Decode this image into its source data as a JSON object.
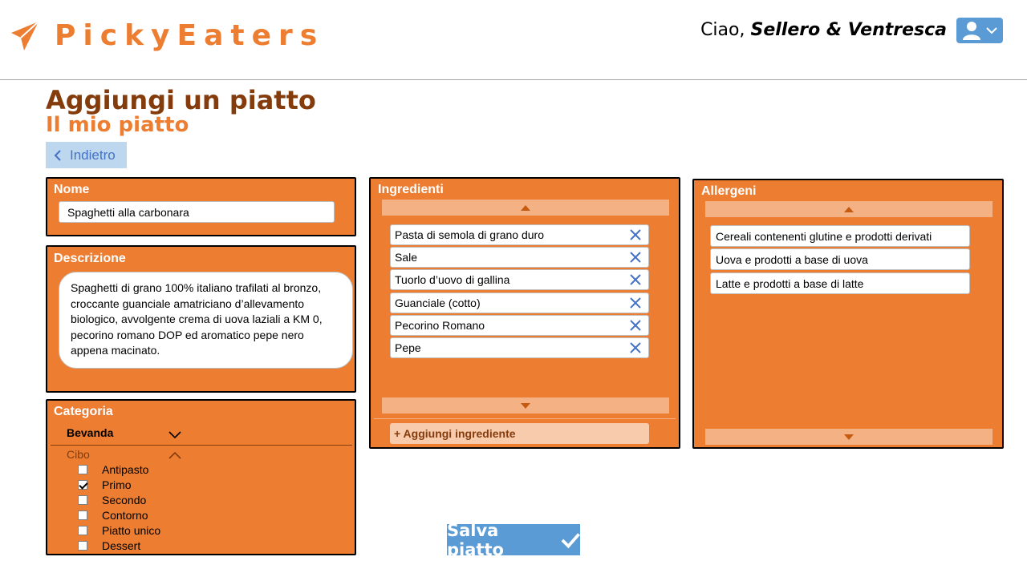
{
  "app": {
    "name": "PickyEaters"
  },
  "header": {
    "greeting": "Ciao,",
    "user": "Sellero & Ventresca"
  },
  "page": {
    "title": "Aggiungi un piatto",
    "subtitle": "Il mio piatto",
    "back_label": "Indietro"
  },
  "nome": {
    "label": "Nome",
    "value": "Spaghetti alla carbonara"
  },
  "descrizione": {
    "label": "Descrizione",
    "value": "Spaghetti di grano 100% italiano trafilati al bronzo, croccante guanciale amatriciano d’allevamento biologico, avvolgente crema di uova laziali a KM 0, pecorino romano DOP ed aromatico pepe nero appena macinato."
  },
  "categoria": {
    "label": "Categoria",
    "bevanda": "Bevanda",
    "cibo": "Cibo",
    "options": [
      {
        "label": "Antipasto",
        "checked": false
      },
      {
        "label": "Primo",
        "checked": true
      },
      {
        "label": "Secondo",
        "checked": false
      },
      {
        "label": "Contorno",
        "checked": false
      },
      {
        "label": "Piatto unico",
        "checked": false
      },
      {
        "label": "Dessert",
        "checked": false
      }
    ]
  },
  "ingredienti": {
    "label": "Ingredienti",
    "items": [
      "Pasta di semola di grano duro",
      "Sale",
      "Tuorlo d’uovo di gallina",
      "Guanciale (cotto)",
      "Pecorino Romano",
      "Pepe"
    ],
    "add_label": "+ Aggiungi ingrediente"
  },
  "allergeni": {
    "label": "Allergeni",
    "items": [
      "Cereali contenenti glutine e prodotti  derivati",
      "Uova e prodotti  a base di uova",
      "Latte e prodotti  a base di latte"
    ]
  },
  "save_label": "Salva piatto",
  "colors": {
    "accent": "#ed7d31",
    "dark_brown": "#843c0c",
    "blue": "#5b9bd5",
    "light_orange": "#f4b183"
  }
}
